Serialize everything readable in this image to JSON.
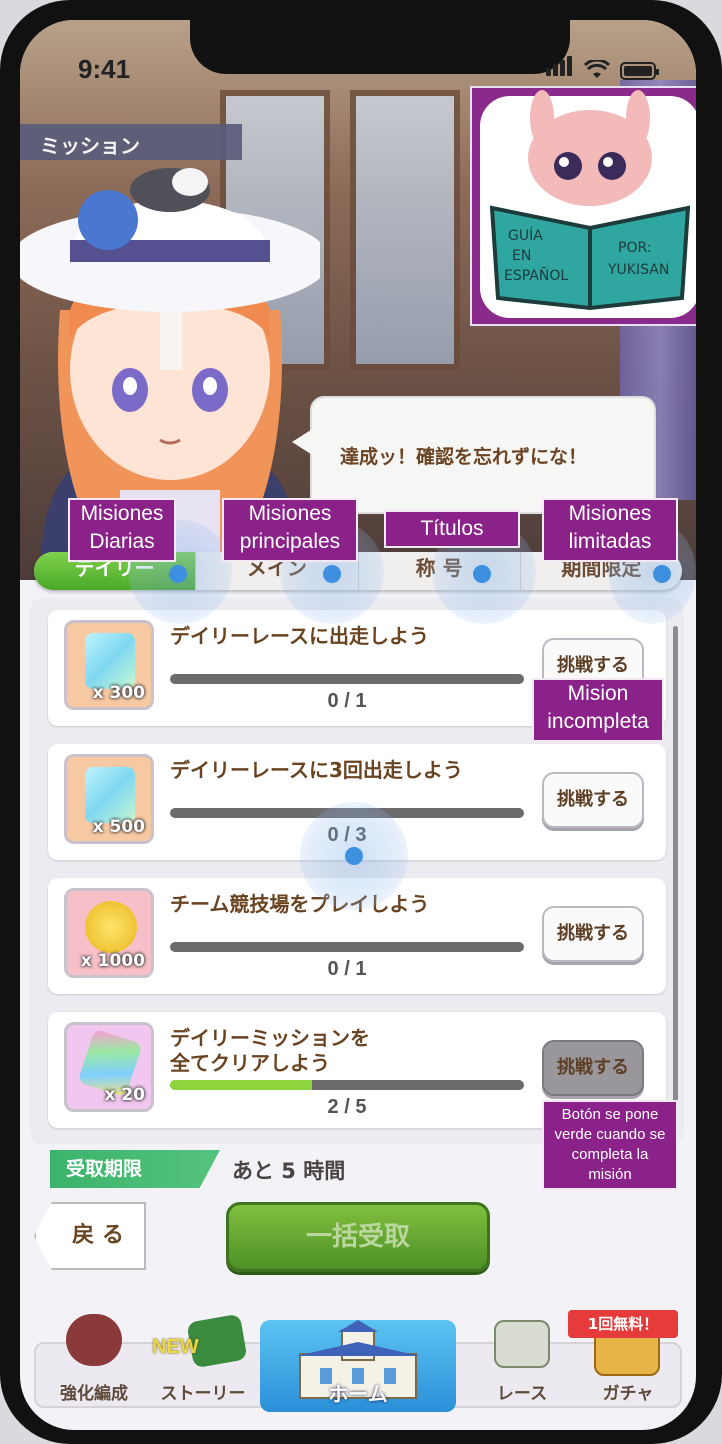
{
  "status_bar": {
    "time": "9:41"
  },
  "header": {
    "title": "ミッション"
  },
  "logo": {
    "line1": "GUÍA",
    "line2": "EN",
    "line3": "ESPAÑOL",
    "line4": "POR:",
    "line5": "YUKISAN"
  },
  "speech": {
    "text": "達成ッ！確認を忘れずにな！"
  },
  "annotations": {
    "daily": [
      "Misiones",
      "Diarias"
    ],
    "main": [
      "Misiones",
      "principales"
    ],
    "titles": "Títulos",
    "limited": [
      "Misiones",
      "limitadas"
    ],
    "incomplete": [
      "Mision",
      "incompleta"
    ],
    "button_note": [
      "Botón se pone",
      "verde cuando se",
      "completa la",
      "misión"
    ]
  },
  "tabs": [
    {
      "label": "デイリー",
      "active": true
    },
    {
      "label": "メイン",
      "active": false
    },
    {
      "label": "称 号",
      "active": false
    },
    {
      "label": "期間限定",
      "active": false
    }
  ],
  "missions": [
    {
      "title": "デイリーレースに出走しよう",
      "reward_qty": "x 300",
      "icon": "ticket-icon",
      "progress_text": "0 / 1",
      "progress": 0.0,
      "button": "挑戦する",
      "dim": false
    },
    {
      "title": "デイリーレースに3回出走しよう",
      "reward_qty": "x 500",
      "icon": "ticket-icon",
      "progress_text": "0 / 3",
      "progress": 0.0,
      "button": "挑戦する",
      "dim": false
    },
    {
      "title": "チーム競技場をプレイしよう",
      "reward_qty": "x 1000",
      "icon": "coin-icon",
      "progress_text": "0 / 1",
      "progress": 0.0,
      "button": "挑戦する",
      "dim": false
    },
    {
      "title": "デイリーミッションを全てクリアしよう",
      "title_l1": "デイリーミッションを",
      "title_l2": "全てクリアしよう",
      "reward_qty": "x 20",
      "icon": "crystal-icon",
      "progress_text": "2 / 5",
      "progress": 0.4,
      "button": "挑戦する",
      "dim": true
    }
  ],
  "deadline": {
    "label": "受取期限",
    "value": "あと 5 時間"
  },
  "buttons": {
    "back": "戻 る",
    "claim_all": "一括受取"
  },
  "nav": {
    "items": [
      {
        "label": "強化編成"
      },
      {
        "label": "ストーリー",
        "badge": "NEW"
      },
      {
        "label": "ホーム"
      },
      {
        "label": "レース"
      },
      {
        "label": "ガチャ",
        "badge": "1回無料！"
      }
    ]
  },
  "colors": {
    "accent_green": "#4aa82a",
    "annotation_purple": "#8a228a",
    "logo_purple": "#8a2b8c"
  }
}
